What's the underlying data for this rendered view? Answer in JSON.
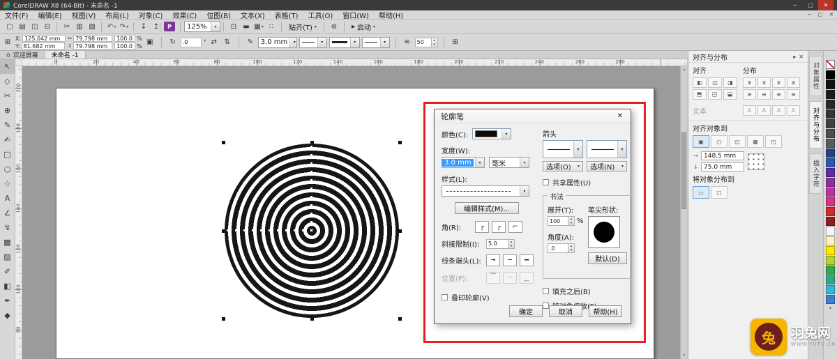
{
  "colors": {
    "annotation_red": "#ec1c24",
    "selection_blue": "#3399ff",
    "pdf_purple": "#7e3597",
    "brand_yellow": "#f7b500"
  },
  "window": {
    "title": "CorelDRAW X8 (64-Bit) - 未命名 -1",
    "minimize": "─",
    "maximize": "▢",
    "close": "✕"
  },
  "menubar": {
    "items": [
      "文件(F)",
      "编辑(E)",
      "视图(V)",
      "布局(L)",
      "对象(C)",
      "效果(C)",
      "位图(B)",
      "文本(X)",
      "表格(T)",
      "工具(O)",
      "窗口(W)",
      "帮助(H)"
    ]
  },
  "toolbar": {
    "icons_left": [
      {
        "name": "new-document-icon",
        "glyph": "▢"
      },
      {
        "name": "open-icon",
        "glyph": "▤"
      },
      {
        "name": "save-icon",
        "glyph": "◫"
      },
      {
        "name": "print-icon",
        "glyph": "⊟"
      },
      {
        "name": "cut-icon",
        "glyph": "✂",
        "cls": "gap"
      },
      {
        "name": "copy-icon",
        "glyph": "▥"
      },
      {
        "name": "paste-icon",
        "glyph": "▧"
      },
      {
        "name": "undo-icon",
        "glyph": "↶",
        "cls": "gap dd"
      },
      {
        "name": "redo-icon",
        "glyph": "↷",
        "cls": "dd"
      },
      {
        "name": "import-icon",
        "glyph": "↧",
        "cls": "gap"
      },
      {
        "name": "export-icon",
        "glyph": "↥"
      },
      {
        "name": "publish-pdf-icon",
        "glyph": "P",
        "cls": "pdf gap"
      }
    ],
    "zoom_value": "125%",
    "icons_mid": [
      {
        "name": "fullscreen-preview-icon",
        "glyph": "⊡",
        "cls": "gap"
      },
      {
        "name": "show-rulers-icon",
        "glyph": "▬"
      },
      {
        "name": "show-grid-icon",
        "glyph": "▦",
        "cls": "dd"
      },
      {
        "name": "show-guidelines-icon",
        "glyph": "∷"
      }
    ],
    "snap_label": "贴齐(T)",
    "launch_label": "启动"
  },
  "propertybar": {
    "x_label": "X:",
    "x_value": "125.042 mm",
    "y_label": "Y:",
    "y_value": "81.682 mm",
    "width_value": "79.798 mm",
    "height_value": "79.798 mm",
    "scale_x": "100.0",
    "scale_y": "100.0",
    "percent": "%",
    "angle_value": ".0",
    "degree": "°",
    "outline_width": "3.0 mm",
    "steps_value": "50"
  },
  "icons": {
    "position_grid": "⊞",
    "size_h": "↔",
    "size_v": "↕",
    "lock": "▣",
    "angle": "↻",
    "mirror_h": "⇄",
    "mirror_v": "⇅",
    "outline_pen": "✎",
    "wrap": "≋",
    "gear": "⊛",
    "launch": "▸",
    "home": "⌂",
    "flyout": "▸",
    "close": "✕",
    "x_axis": "→",
    "y_axis": "↓",
    "corner_miter": "┌",
    "corner_round": "╭",
    "corner_bevel": "⌐",
    "cap_butt": "╼",
    "cap_round": "─",
    "cap_square": "━",
    "pos_outside": "▔",
    "pos_center": "─",
    "pos_inside": "▁",
    "scroll_down": "▾",
    "center_marker": "✕"
  },
  "doctabs": {
    "welcome": "欢迎屏幕",
    "document": "未命名 -1"
  },
  "rulers": {
    "h_numbers": [
      "0",
      "20",
      "40",
      "60",
      "80",
      "100",
      "120",
      "140",
      "160",
      "180",
      "200",
      "220",
      "240",
      "260",
      "280"
    ],
    "v_numbers": [
      "200",
      "180",
      "160",
      "140",
      "120",
      "100",
      "80"
    ]
  },
  "toolbox": {
    "tools": [
      {
        "name": "pick-tool",
        "glyph": "↖"
      },
      {
        "name": "shape-tool",
        "glyph": "◇"
      },
      {
        "name": "crop-tool",
        "glyph": "✂"
      },
      {
        "name": "zoom-tool",
        "glyph": "⊕"
      },
      {
        "name": "freehand-tool",
        "glyph": "✎"
      },
      {
        "name": "artistic-media-tool",
        "glyph": "✍"
      },
      {
        "name": "rectangle-tool",
        "glyph": "□"
      },
      {
        "name": "ellipse-tool",
        "glyph": "○"
      },
      {
        "name": "polygon-tool",
        "glyph": "☆"
      },
      {
        "name": "text-tool",
        "glyph": "A"
      },
      {
        "name": "dimension-tool",
        "glyph": "∠"
      },
      {
        "name": "connector-tool",
        "glyph": "↯"
      },
      {
        "name": "drop-shadow-tool",
        "glyph": "▩"
      },
      {
        "name": "transparency-tool",
        "glyph": "▨"
      },
      {
        "name": "eyedropper-tool",
        "glyph": "✐"
      },
      {
        "name": "interactive-fill-tool",
        "glyph": "◧"
      },
      {
        "name": "outline-pen-tool",
        "glyph": "✒"
      },
      {
        "name": "fill-tool",
        "glyph": "◆"
      }
    ]
  },
  "dialog": {
    "title": "轮廓笔",
    "close": "✕",
    "color_label": "颜色(C):",
    "width_label": "宽度(W):",
    "width_value": "3.0 mm",
    "width_unit": "毫米",
    "style_label": "样式(L):",
    "edit_style_button": "编辑样式(M)...",
    "corners_label": "角(R):",
    "miter_label": "斜接限制(I):",
    "miter_value": "5.0",
    "caps_label": "线条端头(L):",
    "position_label": "位置(P):",
    "overprint_checkbox": "叠印轮廓(V)",
    "arrows_label": "箭头",
    "options_left_button": "选项(O)",
    "options_right_button": "选项(N)",
    "share_checkbox": "共享属性(U)",
    "calligraphy_label": "书法",
    "stretch_label": "展开(T):",
    "stretch_value": "100",
    "stretch_unit": "%",
    "angle_label": "角度(A):",
    "angle_value": ".0",
    "nib_label": "笔尖形状:",
    "default_button": "默认(D)",
    "behind_fill_checkbox": "填充之后(B)",
    "scale_with_object_checkbox": "随对象缩放(F)",
    "ok_button": "确定",
    "cancel_button": "取消",
    "help_button": "帮助(H)"
  },
  "docker": {
    "title": "对齐与分布",
    "align_label": "对齐",
    "distribute_label": "分布",
    "text_label": "文本",
    "align_to_label": "对齐对象到",
    "distribute_to_label": "将对象分布到",
    "x_value": "148.5 mm",
    "y_value": "75.0 mm",
    "align_icons": [
      {
        "name": "align-left-icon",
        "glyph": "◧"
      },
      {
        "name": "align-center-h-icon",
        "glyph": "◫"
      },
      {
        "name": "align-right-icon",
        "glyph": "◨"
      },
      {
        "name": "align-top-icon",
        "glyph": "◧",
        "cls": "rot90"
      },
      {
        "name": "align-center-v-icon",
        "glyph": "◫",
        "cls": "rot90"
      },
      {
        "name": "align-bottom-icon",
        "glyph": "◨",
        "cls": "rot90"
      }
    ],
    "distribute_icons": [
      {
        "name": "distribute-left-icon",
        "glyph": "≡",
        "cls": "rot90"
      },
      {
        "name": "distribute-center-h-icon",
        "glyph": "≡",
        "cls": "rot90"
      },
      {
        "name": "distribute-spacing-h-icon",
        "glyph": "≡",
        "cls": "rot90"
      },
      {
        "name": "distribute-right-icon",
        "glyph": "≡",
        "cls": "rot90"
      },
      {
        "name": "distribute-top-icon",
        "glyph": "≡"
      },
      {
        "name": "distribute-center-v-icon",
        "glyph": "≡"
      },
      {
        "name": "distribute-spacing-v-icon",
        "glyph": "≡"
      },
      {
        "name": "distribute-bottom-icon",
        "glyph": "≡"
      }
    ],
    "text_icons": [
      {
        "name": "align-first-baseline-icon",
        "glyph": "A"
      },
      {
        "name": "align-last-baseline-icon",
        "glyph": "A"
      },
      {
        "name": "align-bounding-box-icon",
        "glyph": "A"
      },
      {
        "name": "align-text-outline-icon",
        "glyph": "A"
      }
    ],
    "align_to_icons": [
      {
        "name": "align-to-active-objects-icon",
        "glyph": "▣",
        "box": "on"
      },
      {
        "name": "align-to-page-edge-icon",
        "glyph": "▢"
      },
      {
        "name": "align-to-page-center-icon",
        "glyph": "◫"
      },
      {
        "name": "align-to-grid-icon",
        "glyph": "▦"
      },
      {
        "name": "align-to-point-icon",
        "glyph": "◰"
      }
    ],
    "distribute_to_icons": [
      {
        "name": "distribute-to-selection-icon",
        "glyph": "▭",
        "box": "on"
      },
      {
        "name": "distribute-to-page-icon",
        "glyph": "▢"
      }
    ]
  },
  "side_tabs": [
    {
      "label": "对象属性",
      "cls": ""
    },
    {
      "label": "对齐与分布",
      "cls": "active"
    },
    {
      "label": "插入字符",
      "cls": ""
    }
  ],
  "palette": {
    "colors": [
      "#000000",
      "#111111",
      "#1c1c1c",
      "#282828",
      "#343434",
      "#404040",
      "#4d4d4d",
      "#5a5a5a",
      "#23407f",
      "#2f55b0",
      "#5b2d9e",
      "#8c2f9e",
      "#c02fa0",
      "#d8337f",
      "#cf2b2b",
      "#8f1d1d",
      "#f5f5f5",
      "#fdf3c0",
      "#ffe800",
      "#b5d334",
      "#3aa546",
      "#2ca88c",
      "#31b8d8",
      "#3a7fd0"
    ]
  },
  "watermark": {
    "brand": "羽兔网",
    "url": "WWW.YUTU.CN",
    "logo_glyph": "兔"
  }
}
